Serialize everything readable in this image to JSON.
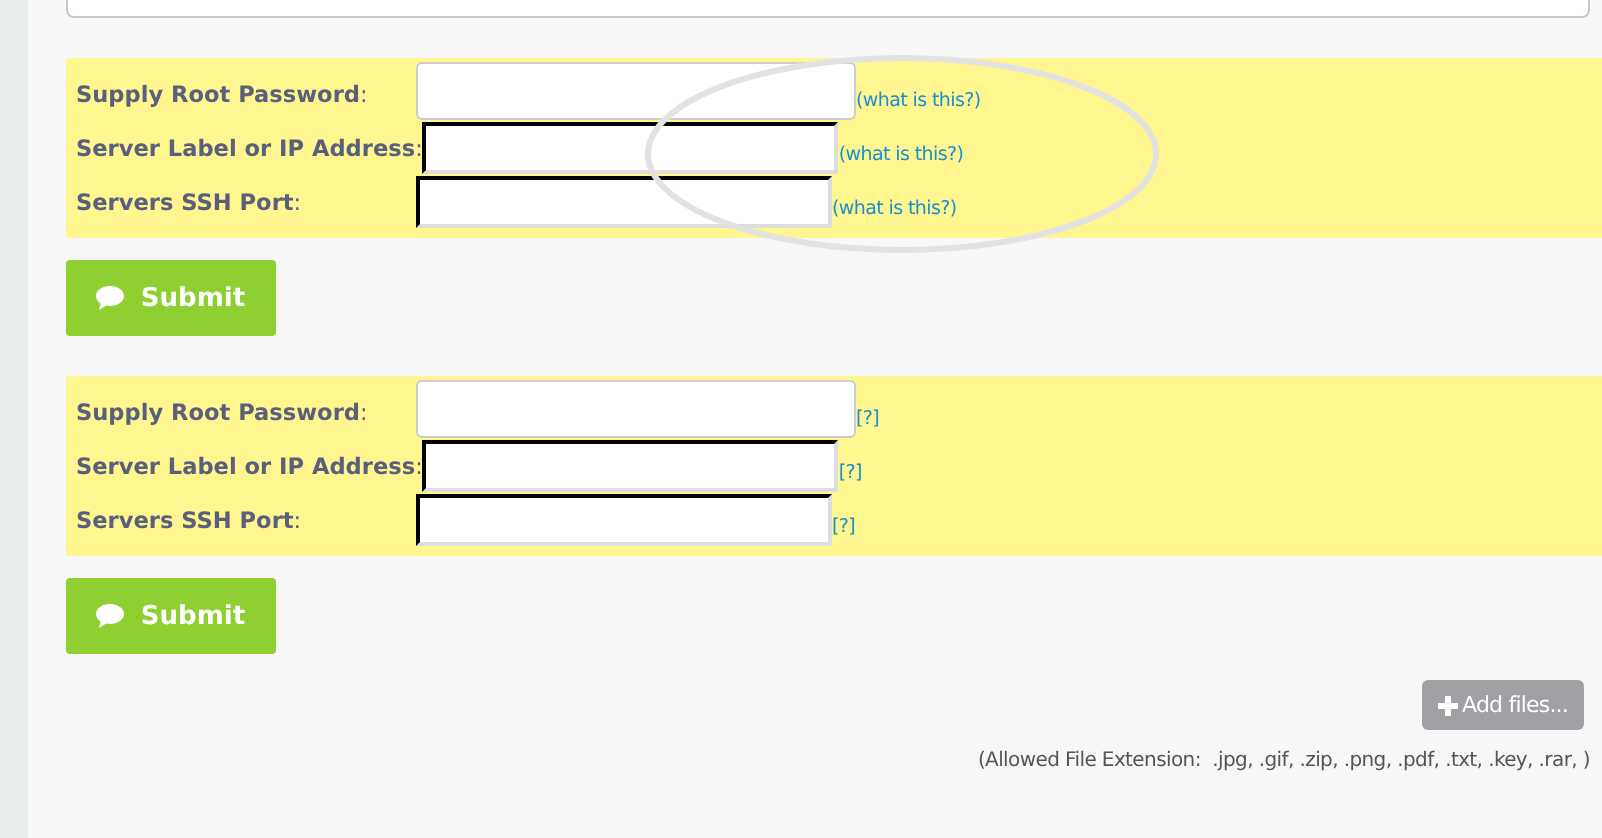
{
  "forms": [
    {
      "fields": [
        {
          "label": "**Supply Root Password**:",
          "help": "(what is this?)"
        },
        {
          "label": "**Server Label or IP Address**:",
          "help": "(what is this?)"
        },
        {
          "label": "**Servers SSH Port**:",
          "help": "(what is this?)"
        }
      ],
      "highlighted": true,
      "submit": "Submit"
    },
    {
      "fields": [
        {
          "label": "**Supply Root Password**:",
          "help": "[?]"
        },
        {
          "label": "**Server Label or IP Address**:",
          "help": "[?]"
        },
        {
          "label": "**Servers SSH Port**:",
          "help": "[?]"
        }
      ],
      "highlighted": false,
      "submit": "Submit"
    }
  ],
  "add_files": "Add files...",
  "allowed_note": "(Allowed File Extension:  .jpg, .gif, .zip, .png, .pdf, .txt, .key, .rar, )"
}
